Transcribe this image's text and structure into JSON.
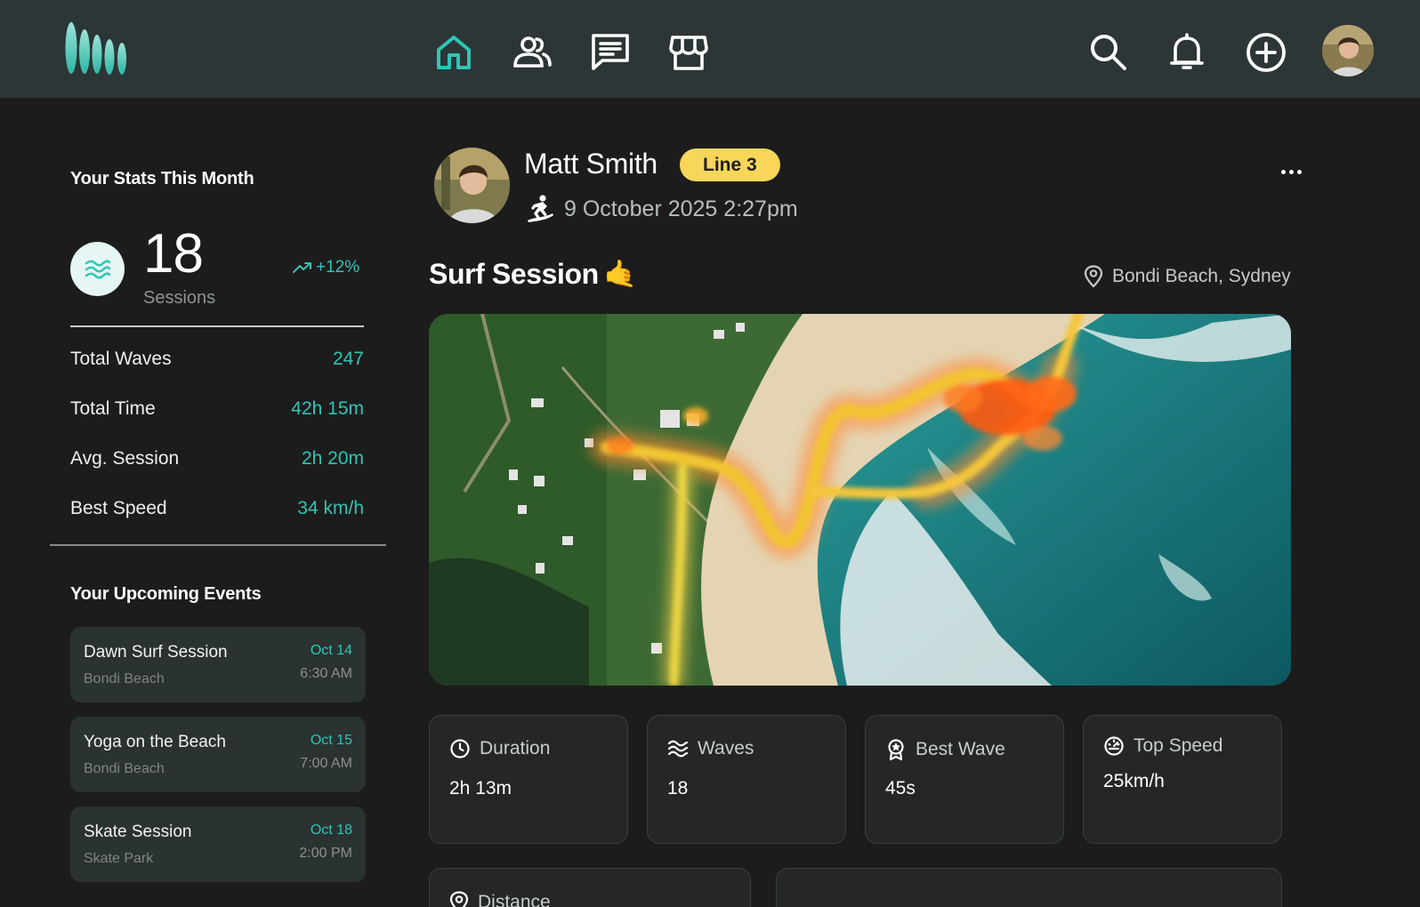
{
  "header": {
    "nav": [
      {
        "icon": "home-icon",
        "active": true
      },
      {
        "icon": "community-icon",
        "active": false
      },
      {
        "icon": "messages-icon",
        "active": false
      },
      {
        "icon": "store-icon",
        "active": false
      }
    ],
    "actions": [
      "search-icon",
      "bell-icon",
      "add-circle-icon"
    ]
  },
  "stats": {
    "title": "Your Stats This Month",
    "sessions_count": "18",
    "sessions_label": "Sessions",
    "trend": "+12%",
    "rows": [
      {
        "label": "Total Waves",
        "value": "247"
      },
      {
        "label": "Total Time",
        "value": "42h 15m"
      },
      {
        "label": "Avg. Session",
        "value": "2h 20m"
      },
      {
        "label": "Best Speed",
        "value": "34 km/h"
      }
    ]
  },
  "events": {
    "title": "Your Upcoming Events",
    "items": [
      {
        "title": "Dawn Surf Session",
        "location": "Bondi Beach",
        "date": "Oct 14",
        "time": "6:30 AM"
      },
      {
        "title": "Yoga on the Beach",
        "location": "Bondi Beach",
        "date": "Oct 15",
        "time": "7:00 AM"
      },
      {
        "title": "Skate Session",
        "location": "Skate Park",
        "date": "Oct 18",
        "time": "2:00 PM"
      }
    ]
  },
  "post": {
    "author": "Matt Smith",
    "badge": "Line 3",
    "datetime": "9 October 2025 2:27pm",
    "title": "Surf Session",
    "title_emoji": "🤙",
    "location": "Bondi Beach, Sydney",
    "metrics": [
      {
        "label": "Duration",
        "value": "2h 13m",
        "icon": "clock-icon"
      },
      {
        "label": "Waves",
        "value": "18",
        "icon": "waves-icon"
      },
      {
        "label": "Best Wave",
        "value": "45s",
        "icon": "award-icon"
      },
      {
        "label": "Top Speed",
        "value": "25km/h",
        "icon": "speedometer-icon"
      }
    ],
    "metrics_row2": [
      {
        "label": "Distance",
        "icon": "location-pin-icon"
      }
    ]
  },
  "colors": {
    "accent": "#2fc5b5",
    "badge": "#f7d65a",
    "topbar": "#2c3637",
    "background": "#1c1c1c"
  }
}
